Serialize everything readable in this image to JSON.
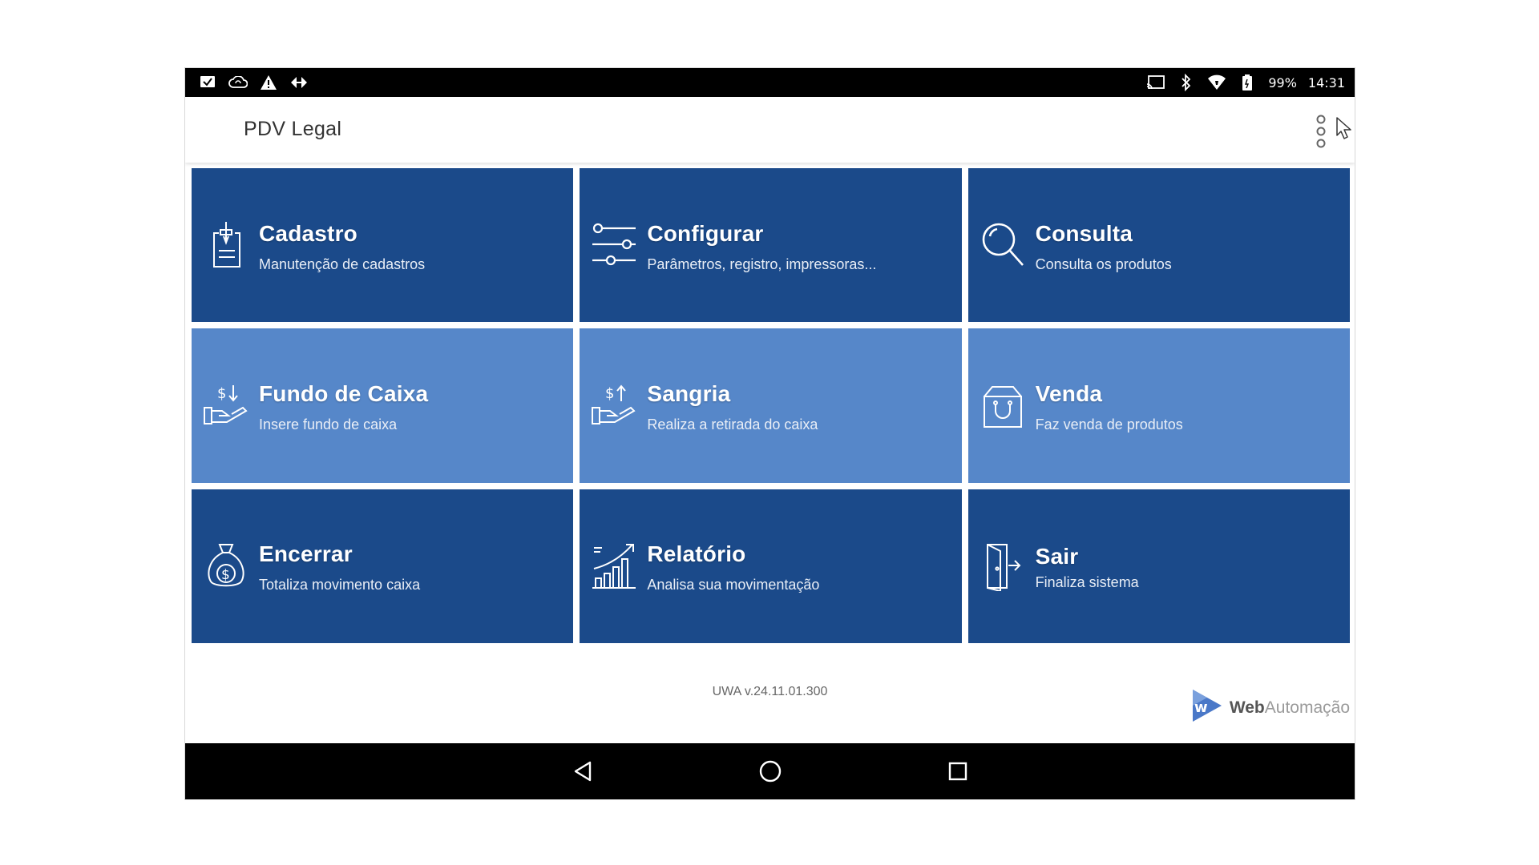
{
  "status_bar": {
    "left_icons": [
      "email-check-icon",
      "cloud-sync-icon",
      "warning-icon",
      "usb-debug-icon"
    ],
    "right_icons": [
      "cast-icon",
      "bluetooth-icon",
      "wifi-icon",
      "battery-icon"
    ],
    "battery": "99%",
    "time": "14:31"
  },
  "app_bar": {
    "title": "PDV Legal",
    "menu_icon": "more-vert-icon"
  },
  "tiles": [
    {
      "title": "Cadastro",
      "subtitle": "Manutenção de cadastros",
      "icon": "clipboard-pen-icon",
      "style": "dark"
    },
    {
      "title": "Configurar",
      "subtitle": "Parâmetros, registro, impressoras...",
      "icon": "sliders-icon",
      "style": "dark"
    },
    {
      "title": "Consulta",
      "subtitle": "Consulta os produtos",
      "icon": "magnifier-icon",
      "style": "dark"
    },
    {
      "title": "Fundo de Caixa",
      "subtitle": "Insere fundo de caixa",
      "icon": "hand-money-in-icon",
      "style": "light"
    },
    {
      "title": "Sangria",
      "subtitle": "Realiza a retirada do caixa",
      "icon": "hand-money-out-icon",
      "style": "light"
    },
    {
      "title": "Venda",
      "subtitle": "Faz venda de produtos",
      "icon": "shopping-bag-icon",
      "style": "light"
    },
    {
      "title": "Encerrar",
      "subtitle": "Totaliza movimento caixa",
      "icon": "money-bag-icon",
      "style": "dark"
    },
    {
      "title": "Relatório",
      "subtitle": "Analisa sua movimentação",
      "icon": "growth-chart-icon",
      "style": "dark"
    },
    {
      "title": "Sair",
      "subtitle": "Finaliza sistema",
      "icon": "exit-door-icon",
      "style": "dark"
    }
  ],
  "footer": {
    "version": "UWA v.24.11.01.300",
    "brand_bold": "Web",
    "brand_light": "Automação"
  },
  "nav_bar": {
    "buttons": [
      "back-icon",
      "home-icon",
      "recents-icon"
    ]
  },
  "colors": {
    "tile_dark": "#1b4a8a",
    "tile_light": "#5687c9",
    "brand_blue": "#4a78c8"
  }
}
